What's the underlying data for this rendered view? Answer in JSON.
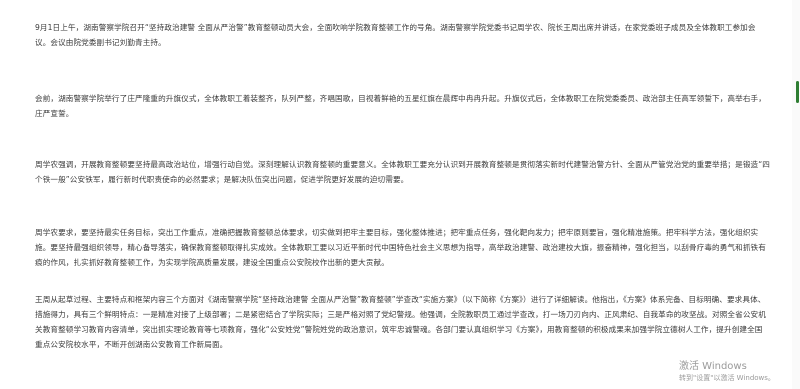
{
  "article": {
    "paragraphs": [
      "9月1日上午，湖南警察学院召开“坚持政治建警 全面从严治警”教育整顿动员大会，全面吹响学院教育整顿工作的号角。湖南警察学院党委书记周学农、院长王周出席并讲话，在家党委班子成员及全体教职工参加会议。会议由院党委副书记刘勤青主持。",
      "会前，湖南警察学院举行了庄严隆重的升旗仪式，全体教职工着装整齐，队列严整，齐唱国歌，目视着鲜艳的五星红旗在晨辉中冉冉升起。升旗仪式后，全体教职工在院党委委员、政治部主任高军领誓下，高举右手，庄严宣誓。",
      "周学农强调，开展教育整顿要坚持最高政治站位，增强行动自觉。深刻理解认识教育整顿的重要意义。全体教职工要充分认识到开展教育整顿是贯彻落实新时代建警治警方针、全面从严管党治党的重要举措；是锻造“四个铁一般”公安铁军，履行新时代职责使命的必然要求；是解决队伍突出问题，促进学院更好发展的迫切需要。",
      "周学农要求，要坚持最实任务目标，突出工作重点，准确把握教育整顿总体要求，切实做到把牢主要目标，强化整体推进；把牢重点任务，强化靶向发力；把牢原则要旨，强化精准施策。把牢科学方法，强化组织实施。要坚持最强组织领导，精心备导落实，确保教育整顿取得扎实成效。全体教职工要以习近平新时代中国特色社会主义思想为指导，高举政治建警、政治建校大旗，振奋精神，强化担当，以刮骨疗毒的勇气和抓铁有痕的作风，扎实抓好教育整顿工作，为实现学院高质量发展，建设全国重点公安院校作出新的更大贡献。",
      "王周从起草过程、主要特点和框架内容三个方面对《湖南警察学院“坚持政治建警 全面从严治警”教育整顿”学查改“实施方案》（以下简称《方案》）进行了详细解读。他指出，《方案》体系完备、目标明确、要求具体、措施得力，具有三个鲜明特点：一是精准对接了上级部署；二是紧密结合了学院实际；三是严格对照了党纪警规。他强调，全院教职员工通过学查改，打一场刀刃向内、正风肃纪、自我革命的攻坚战。对照全省公安机关教育整顿学习教育内容清单，突出抓实理论教育等七项教育，强化“公安姓党”警院姓党的政治意识，筑牢忠诚警魂。各部门要认真组织学习《方案》，用教育整顿的积极成果来加强学院立德树人工作，提升创建全国重点公安院校水平，不断开创湖南公安教育工作新局面。"
    ]
  },
  "os_watermark": {
    "title": "激活 Windows",
    "subtitle": "转到\"设置\"以激活 Windows。"
  },
  "colors": {
    "text": "#3a3a3a",
    "scrollbar_thumb": "#2e7d32",
    "watermark": "#9a9a9a",
    "background": "#ffffff"
  }
}
